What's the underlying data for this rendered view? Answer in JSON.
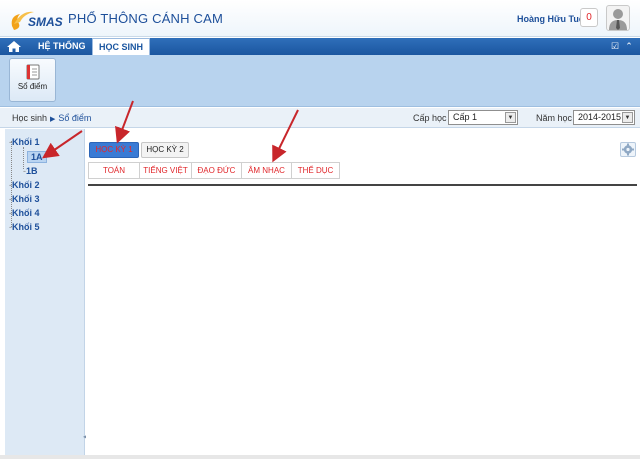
{
  "header": {
    "logo_text": "SMAS",
    "school_name": "PHỔ THÔNG CÁNH CAM",
    "user_name": "Hoàng Hữu Tuệ",
    "notification_count": "0"
  },
  "nav": {
    "items": [
      {
        "label": "HỆ THỐNG"
      },
      {
        "label": "HỌC SINH"
      }
    ],
    "active": "HỌC SINH"
  },
  "ribbon": {
    "buttons": [
      {
        "label": "Sổ điểm",
        "icon": "gradebook-icon"
      }
    ]
  },
  "breadcrumb": {
    "root": "Học sinh",
    "current": "Sổ điểm"
  },
  "filters": {
    "level_label": "Cấp học",
    "level_value": "Cấp 1",
    "year_label": "Năm học",
    "year_value": "2014-2015"
  },
  "tree": {
    "nodes": [
      {
        "label": "Khối 1"
      },
      {
        "label": "1A"
      },
      {
        "label": "1B"
      },
      {
        "label": "Khối 2"
      },
      {
        "label": "Khối 3"
      },
      {
        "label": "Khối 4"
      },
      {
        "label": "Khối 5"
      }
    ],
    "selected": "1A"
  },
  "semesters": {
    "tabs": [
      {
        "label": "HỌC KỲ 1"
      },
      {
        "label": "HỌC KỲ 2"
      }
    ],
    "active": "HỌC KỲ 1"
  },
  "subjects": [
    {
      "label": "TOÁN"
    },
    {
      "label": "TIẾNG VIỆT"
    },
    {
      "label": "ĐẠO ĐỨC"
    },
    {
      "label": "ÂM NHẠC"
    },
    {
      "label": "THỂ DỤC"
    }
  ],
  "colors": {
    "nav_blue": "#1b56a0",
    "ribbon_blue": "#b8d3ee",
    "accent_red": "#e0262a",
    "arrow_red": "#c8262b"
  }
}
